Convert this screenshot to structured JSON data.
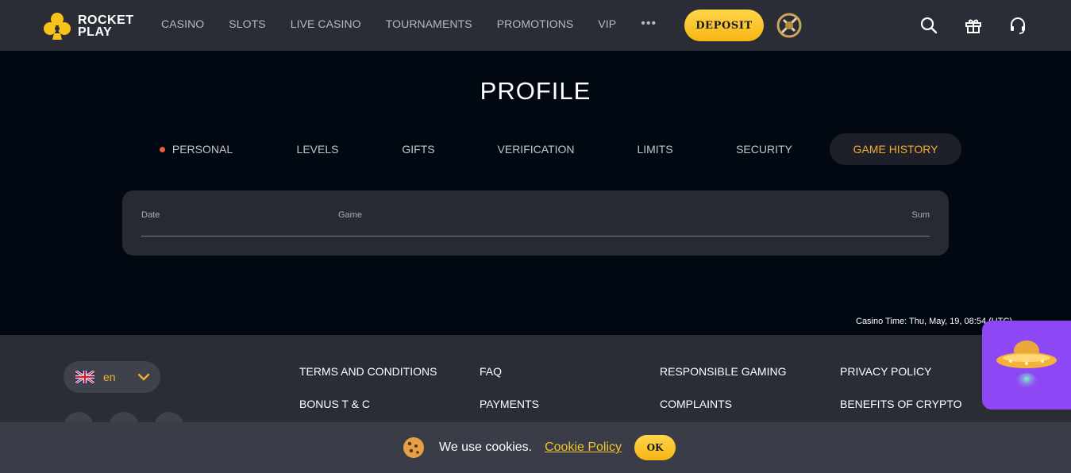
{
  "header": {
    "logo": {
      "line1": "ROCKET",
      "line2": "PLAY",
      "icon": "clover-logo-icon"
    },
    "nav": [
      "CASINO",
      "SLOTS",
      "LIVE CASINO",
      "TOURNAMENTS",
      "PROMOTIONS",
      "VIP"
    ],
    "more_label": "•••",
    "deposit_label": "DEPOSIT",
    "icons": [
      "wheel-bonus-icon",
      "search-icon",
      "gift-icon",
      "headset-icon"
    ]
  },
  "profile": {
    "title": "PROFILE",
    "tabs": [
      "PERSONAL",
      "LEVELS",
      "GIFTS",
      "VERIFICATION",
      "LIMITS",
      "SECURITY",
      "GAME HISTORY"
    ],
    "active_tab": "GAME HISTORY",
    "table": {
      "columns": [
        "Date",
        "Game",
        "Sum"
      ],
      "rows": []
    }
  },
  "casino_time": "Casino Time: Thu, May, 19, 08:54 (UTC)",
  "footer": {
    "language": {
      "code": "en",
      "flag": "uk-flag-icon"
    },
    "links": [
      "TERMS AND CONDITIONS",
      "FAQ",
      "RESPONSIBLE GAMING",
      "PRIVACY POLICY",
      "BONUS T & C",
      "PAYMENTS",
      "COMPLAINTS",
      "BENEFITS OF CRYPTO"
    ]
  },
  "cookie": {
    "text": "We use cookies.",
    "link": "Cookie Policy",
    "ok": "OK"
  },
  "colors": {
    "accent": "#f2ae2f",
    "deposit": "#fcc52c",
    "header_bg": "#2b2d36",
    "page_bg": "#020812",
    "widget": "#8d47f5",
    "notification_dot": "#f05a38"
  }
}
